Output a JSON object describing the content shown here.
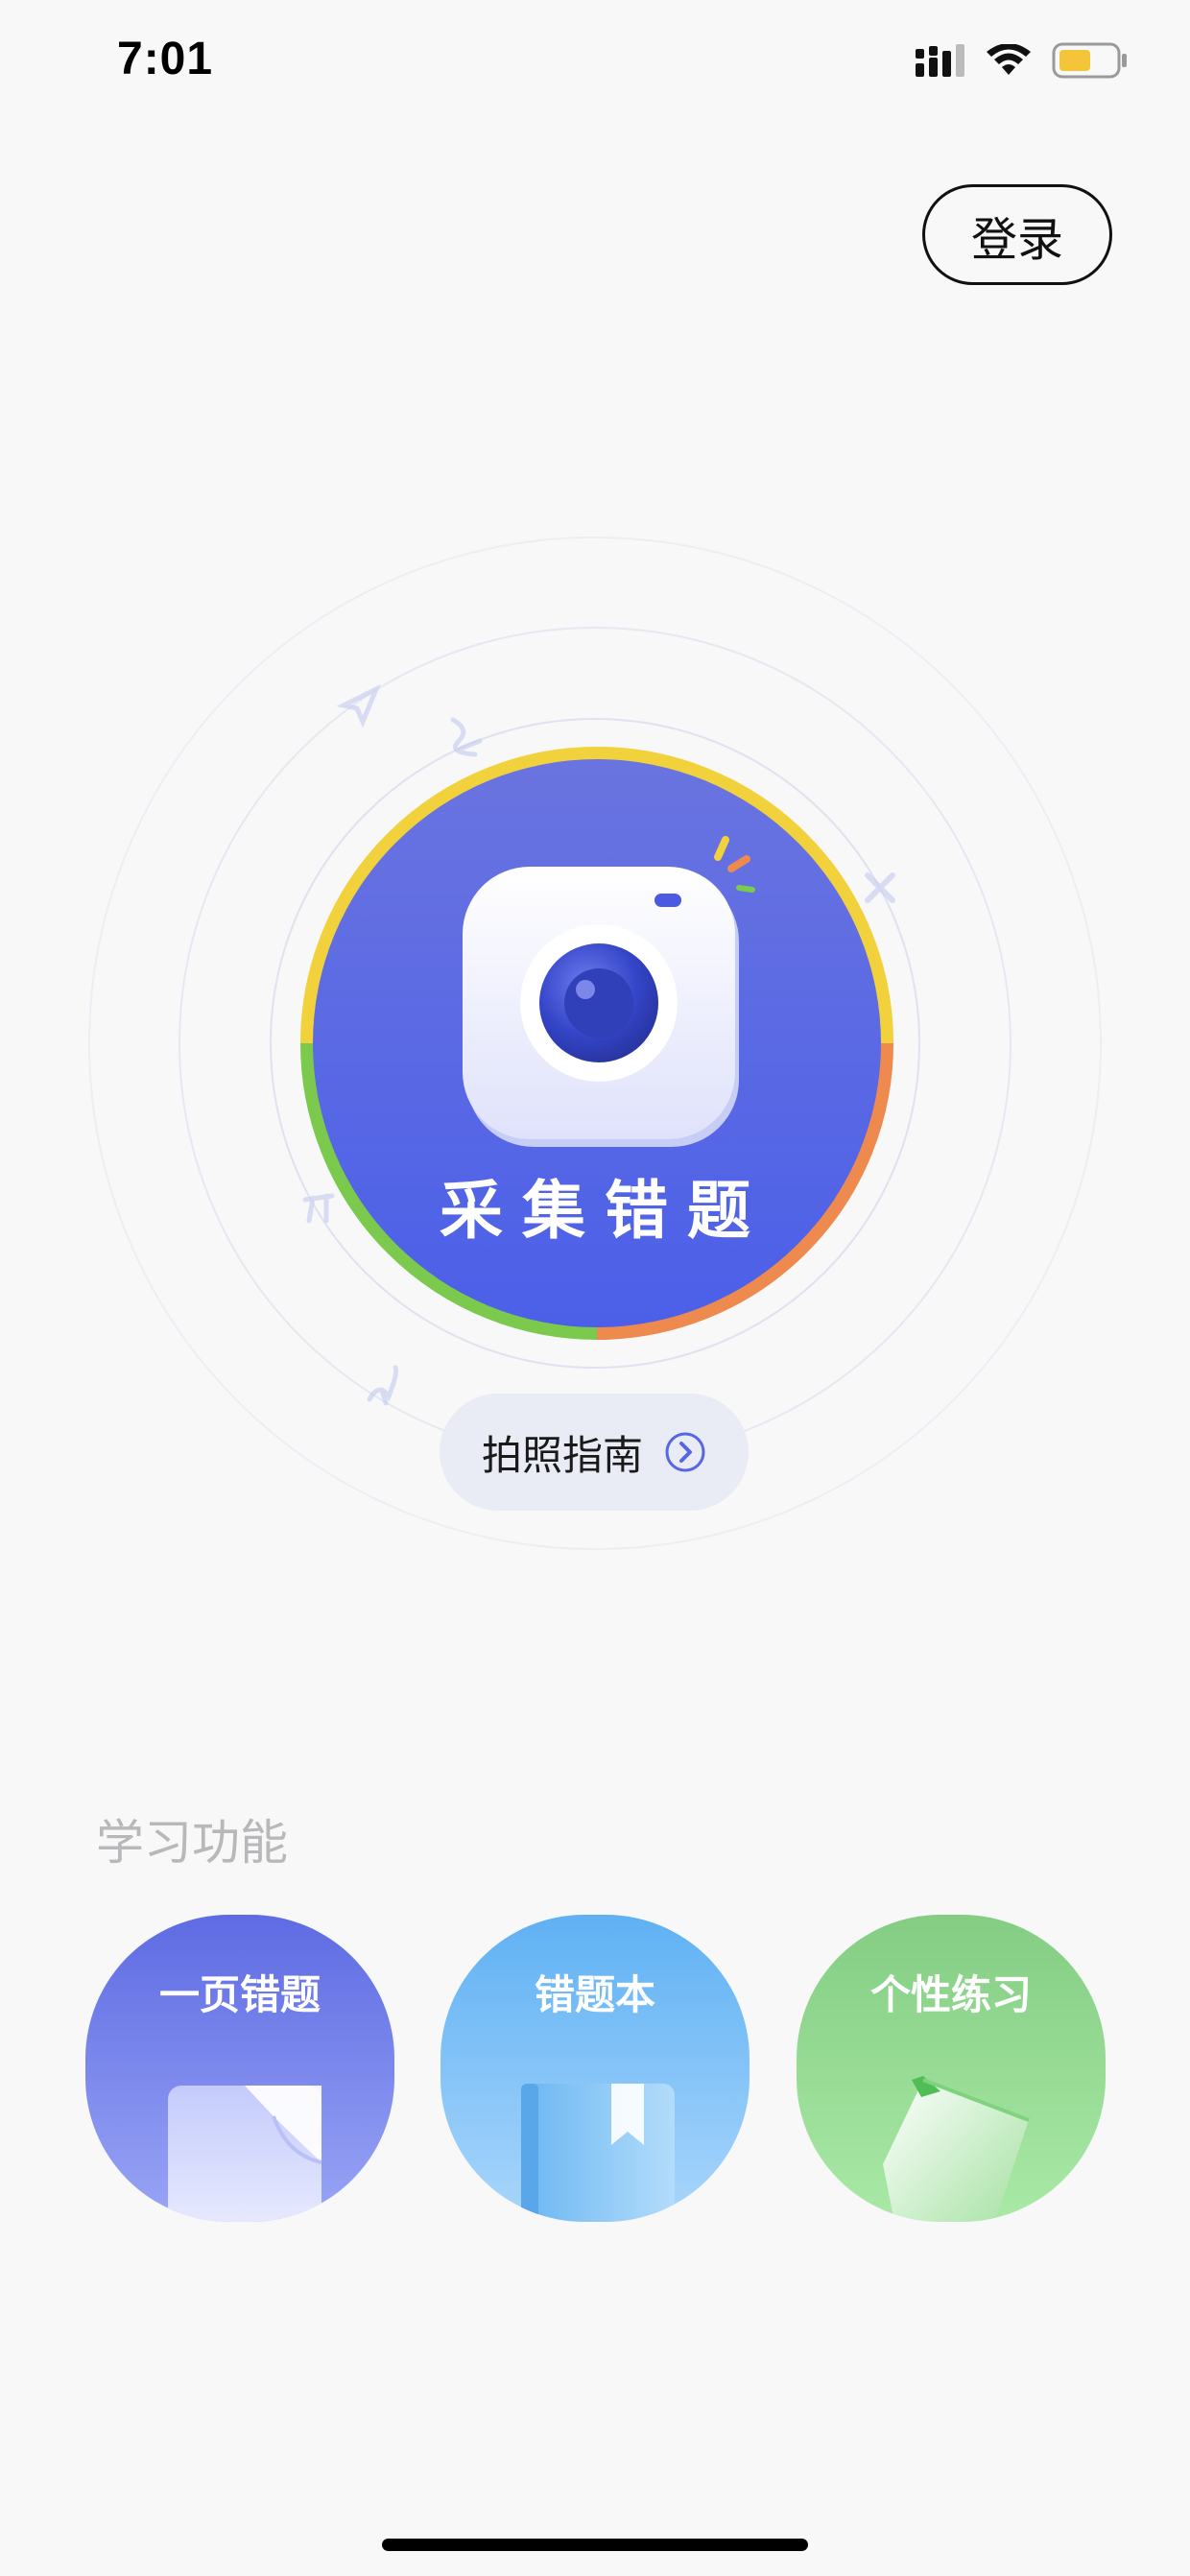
{
  "status_bar": {
    "time": "7:01"
  },
  "header": {
    "login_label": "登录"
  },
  "capture": {
    "label": "采集错题"
  },
  "guide": {
    "label": "拍照指南"
  },
  "features": {
    "title": "学习功能",
    "items": [
      {
        "label": "一页错题",
        "icon": "page-icon",
        "color": "#6675ea"
      },
      {
        "label": "错题本",
        "icon": "book-icon",
        "color": "#6bb8f5"
      },
      {
        "label": "个性练习",
        "icon": "pencil-icon",
        "color": "#8bd78e"
      }
    ]
  },
  "colors": {
    "primary": "#5766e4",
    "ring_yellow": "#f2d23c",
    "ring_orange": "#ee8a4e",
    "ring_green": "#7bc94d",
    "background": "#f8f8f9"
  }
}
